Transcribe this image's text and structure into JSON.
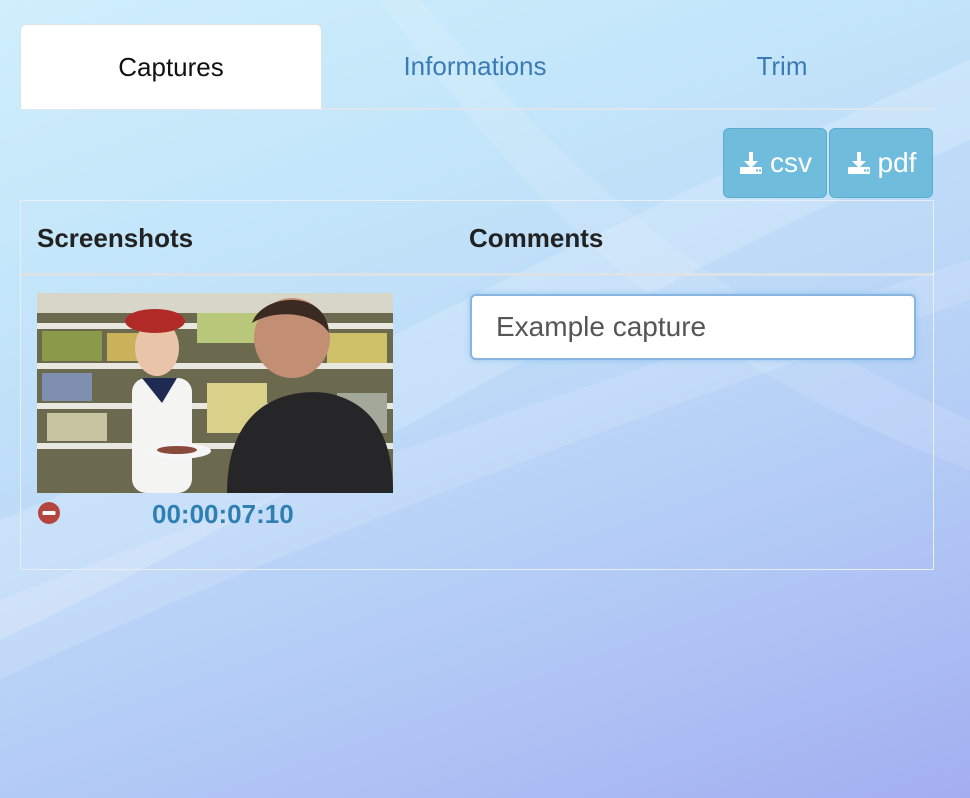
{
  "tabs": [
    {
      "label": "Captures",
      "active": true
    },
    {
      "label": "Informations",
      "active": false
    },
    {
      "label": "Trim",
      "active": false
    }
  ],
  "toolbar": {
    "csv_label": "csv",
    "pdf_label": "pdf",
    "download_icon": "download-icon"
  },
  "table": {
    "headers": [
      "Screenshots",
      "Comments"
    ],
    "rows": [
      {
        "thumbnail_icon": "video-frame-thumbnail",
        "remove_icon": "minus-circle-icon",
        "timecode": "00:00:07:10",
        "comment": "Example capture"
      }
    ]
  },
  "colors": {
    "accent": "#6fbcdc",
    "link": "#3a7bb5",
    "timecode": "#2f7fb2",
    "remove": "#b5463f"
  }
}
